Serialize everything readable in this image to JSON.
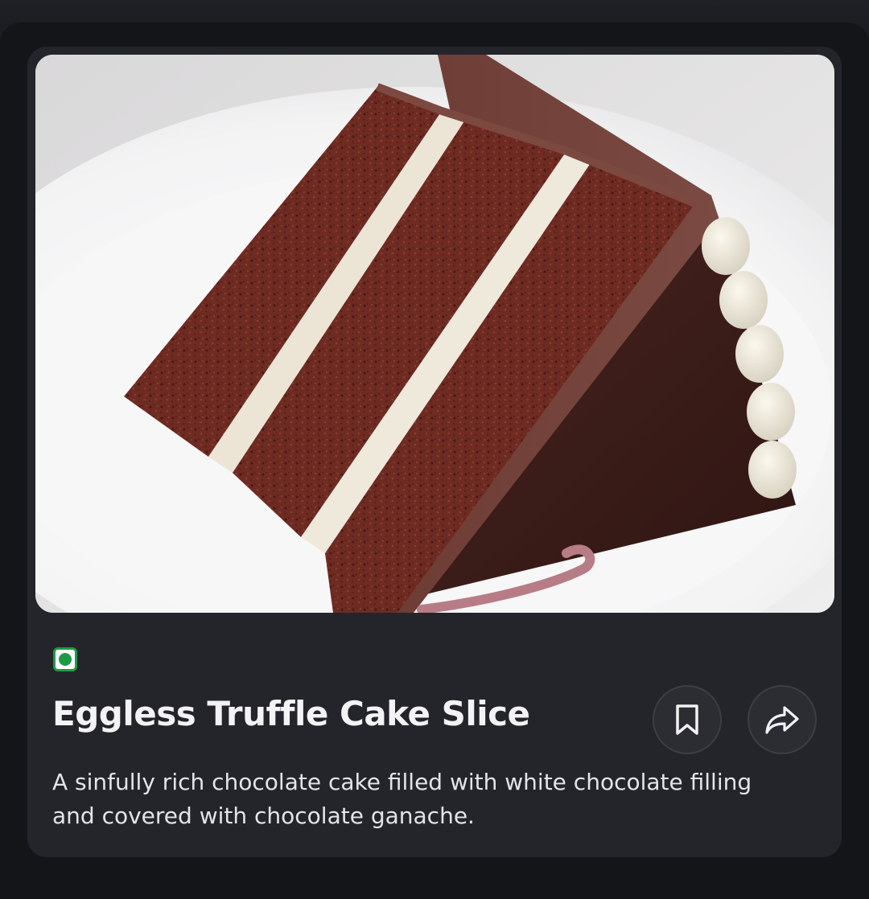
{
  "product": {
    "name": "Eggless Truffle Cake Slice",
    "description": "A sinfully rich chocolate cake filled with white chocolate filling and covered with chocolate ganache.",
    "diet_marker": "veg",
    "diet_marker_color": "#1e9a47",
    "image_subject": "chocolate truffle cake slice on white plate"
  },
  "actions": [
    {
      "id": "bookmark",
      "icon": "bookmark-icon"
    },
    {
      "id": "share",
      "icon": "share-icon"
    }
  ],
  "theme": {
    "card_background": "#24252b",
    "page_background": "#141518",
    "title_color": "#f3f3f5",
    "text_color": "#e4e4e8"
  }
}
